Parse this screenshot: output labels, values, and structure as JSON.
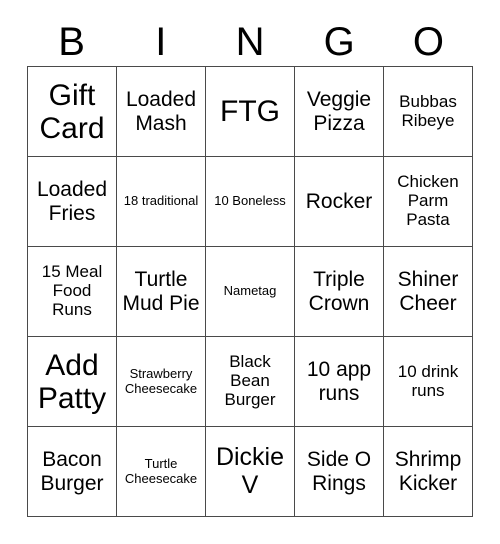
{
  "card": {
    "header_letters": [
      "B",
      "I",
      "N",
      "G",
      "O"
    ],
    "rows": [
      [
        {
          "text": "Gift Card",
          "size": "xl"
        },
        {
          "text": "Loaded Mash",
          "size": "md"
        },
        {
          "text": "FTG",
          "size": "xl"
        },
        {
          "text": "Veggie Pizza",
          "size": "md"
        },
        {
          "text": "Bubbas Ribeye",
          "size": "sm"
        }
      ],
      [
        {
          "text": "Loaded Fries",
          "size": "md"
        },
        {
          "text": "18 traditional",
          "size": "xs"
        },
        {
          "text": "10 Boneless",
          "size": "xs"
        },
        {
          "text": "Rocker",
          "size": "md"
        },
        {
          "text": "Chicken Parm Pasta",
          "size": "sm"
        }
      ],
      [
        {
          "text": "15 Meal Food Runs",
          "size": "sm"
        },
        {
          "text": "Turtle Mud Pie",
          "size": "md"
        },
        {
          "text": "Nametag",
          "size": "xs"
        },
        {
          "text": "Triple Crown",
          "size": "md"
        },
        {
          "text": "Shiner Cheer",
          "size": "md"
        }
      ],
      [
        {
          "text": "Add Patty",
          "size": "xl"
        },
        {
          "text": "Strawberry Cheesecake",
          "size": "xs"
        },
        {
          "text": "Black Bean Burger",
          "size": "sm"
        },
        {
          "text": "10 app runs",
          "size": "md"
        },
        {
          "text": "10 drink runs",
          "size": "sm"
        }
      ],
      [
        {
          "text": "Bacon Burger",
          "size": "md"
        },
        {
          "text": "Turtle Cheesecake",
          "size": "xs"
        },
        {
          "text": "Dickie V",
          "size": "lg"
        },
        {
          "text": "Side O Rings",
          "size": "md"
        },
        {
          "text": "Shrimp Kicker",
          "size": "md"
        }
      ]
    ],
    "colors": {
      "border": "#4a4a4a",
      "background": "#ffffff",
      "text": "#000000"
    }
  }
}
